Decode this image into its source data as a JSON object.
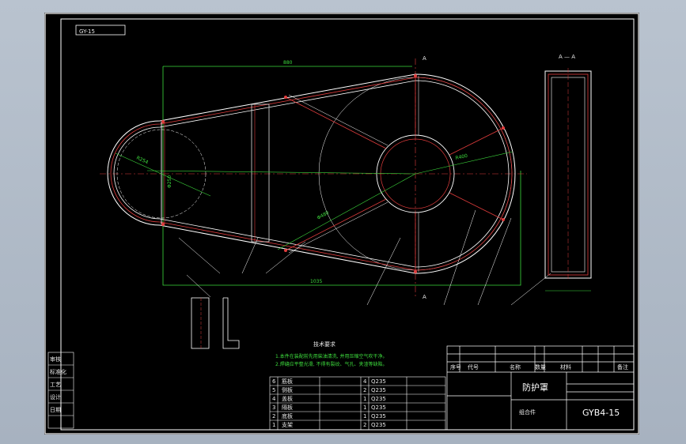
{
  "title_block": {
    "part_label": "GY-15",
    "drawing_name": "防护罩",
    "drawing_number": "GYB4-15",
    "assembly_label": "组合件",
    "tech_title": "技术要求",
    "tech_line1": "1.本件在装配前先用柴油清洗, 并用压缩空气吹干净。",
    "tech_line2": "2.焊缝应平整光滑, 不得有裂纹、气孔、夹渣等缺陷。",
    "col_seq": "序号",
    "col_code": "代号",
    "col_name": "名称",
    "col_qty": "数量",
    "col_mat": "材料",
    "col_note": "备注"
  },
  "dimensions": {
    "top_width": "880",
    "bottom_width": "1035",
    "section_label": "A — A",
    "mark_a": "A",
    "r_left": "R254",
    "r_right": "R400",
    "d_small": "Φ250",
    "d_big": "Φ480"
  },
  "parts_list": {
    "rows": [
      {
        "n": "6",
        "name": "筋板",
        "q": "4",
        "m": "Q235"
      },
      {
        "n": "5",
        "name": "侧板",
        "q": "2",
        "m": "Q235"
      },
      {
        "n": "4",
        "name": "盖板",
        "q": "1",
        "m": "Q235"
      },
      {
        "n": "3",
        "name": "隔板",
        "q": "1",
        "m": "Q235"
      },
      {
        "n": "2",
        "name": "底板",
        "q": "1",
        "m": "Q235"
      },
      {
        "n": "1",
        "name": "支架",
        "q": "2",
        "m": "Q235"
      }
    ]
  },
  "left_sidebar": [
    "审核",
    "标准化",
    "工艺",
    "设计",
    "日期"
  ],
  "colors": {
    "outline": "#ffffff",
    "red": "#e03c3c",
    "green": "#36d636",
    "background": "#000000"
  }
}
